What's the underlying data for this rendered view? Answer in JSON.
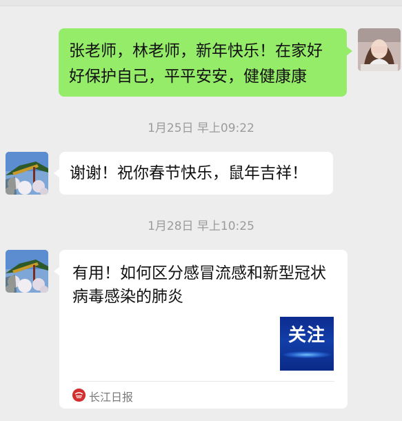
{
  "messages": {
    "outgoing": {
      "text": "张老师，林老师，新年快乐！在家好好保护自己，平平安安，健健康康"
    },
    "timestamp1": "1月25日 早上09:22",
    "reply": {
      "text": "谢谢！祝你春节快乐，鼠年吉祥！"
    },
    "timestamp2": "1月28日 早上10:25",
    "link_card": {
      "title": "有用！如何区分感冒流感和新型冠状病毒感染的肺炎",
      "thumbnail_text": "关注",
      "source": "长江日报"
    }
  },
  "colors": {
    "chat_background": "#ededed",
    "outgoing_bubble": "#95ec69",
    "incoming_bubble": "#ffffff",
    "timestamp_text": "#9b9b9b",
    "source_logo": "#d32f2f"
  },
  "icons": {
    "self_avatar": "user-photo-avatar",
    "contact_avatar": "pavilion-photo-avatar",
    "source_logo": "newspaper-logo-icon"
  }
}
